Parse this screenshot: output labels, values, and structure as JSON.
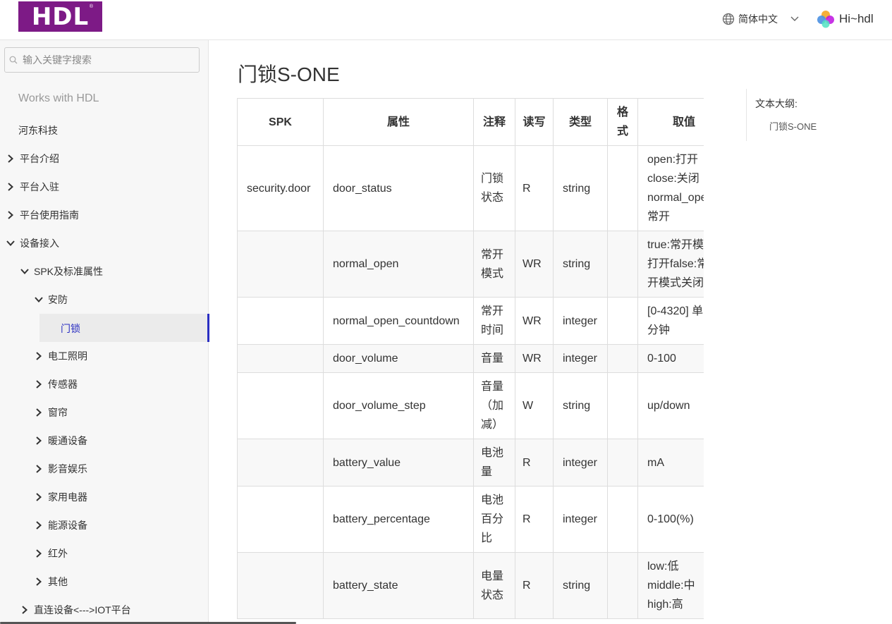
{
  "header": {
    "logo_text": "HDL",
    "logo_reg": "®",
    "language": "简体中文",
    "user_greeting": "Hi~hdl"
  },
  "colors": {
    "brand": "#7d1a86",
    "accent": "#2a2ec2"
  },
  "sidebar": {
    "search_placeholder": "输入关键字搜索",
    "works_with": "Works with HDL",
    "items": [
      {
        "label": "河东科技",
        "arrow": "none"
      },
      {
        "label": "平台介绍",
        "arrow": "right"
      },
      {
        "label": "平台入驻",
        "arrow": "right"
      },
      {
        "label": "平台使用指南",
        "arrow": "right"
      },
      {
        "label": "设备接入",
        "arrow": "down"
      },
      {
        "label": "SPK及标准属性",
        "arrow": "down"
      },
      {
        "label": "安防",
        "arrow": "down"
      },
      {
        "label": "门锁",
        "arrow": "none",
        "active": true
      },
      {
        "label": "电工照明",
        "arrow": "right"
      },
      {
        "label": "传感器",
        "arrow": "right"
      },
      {
        "label": "窗帘",
        "arrow": "right"
      },
      {
        "label": "暖通设备",
        "arrow": "right"
      },
      {
        "label": "影音娱乐",
        "arrow": "right"
      },
      {
        "label": "家用电器",
        "arrow": "right"
      },
      {
        "label": "能源设备",
        "arrow": "right"
      },
      {
        "label": "红外",
        "arrow": "right"
      },
      {
        "label": "其他",
        "arrow": "right"
      },
      {
        "label": "直连设备<--->IOT平台",
        "arrow": "right"
      }
    ]
  },
  "main": {
    "title": "门锁S-ONE",
    "table": {
      "headers": [
        "SPK",
        "属性",
        "注释",
        "读写",
        "类型",
        "格式",
        "取值"
      ],
      "rows": [
        {
          "spk": "security.door",
          "prop": "door_status",
          "note": "门锁状态",
          "rw": "R",
          "type": "string",
          "fmt": "",
          "val": [
            "open:打开",
            "close:关闭",
            "normal_ope",
            "常开"
          ]
        },
        {
          "spk": "",
          "prop": "normal_open",
          "note": "常开模式",
          "rw": "WR",
          "type": "string",
          "fmt": "",
          "val": [
            "true:常开模",
            "打开false:常",
            "开模式关闭"
          ]
        },
        {
          "spk": "",
          "prop": "normal_open_countdown",
          "note": "常开时间",
          "rw": "WR",
          "type": "integer",
          "fmt": "",
          "val": [
            "[0-4320] 单",
            "分钟"
          ]
        },
        {
          "spk": "",
          "prop": "door_volume",
          "note": "音量",
          "rw": "WR",
          "type": "integer",
          "fmt": "",
          "val": [
            "0-100"
          ]
        },
        {
          "spk": "",
          "prop": "door_volume_step",
          "note": "音量（加减）",
          "rw": "W",
          "type": "string",
          "fmt": "",
          "val": [
            "up/down"
          ]
        },
        {
          "spk": "",
          "prop": "battery_value",
          "note": "电池量",
          "rw": "R",
          "type": "integer",
          "fmt": "",
          "val": [
            "mA"
          ]
        },
        {
          "spk": "",
          "prop": "battery_percentage",
          "note": "电池百分比",
          "rw": "R",
          "type": "integer",
          "fmt": "",
          "val": [
            "0-100(%)"
          ]
        },
        {
          "spk": "",
          "prop": "battery_state",
          "note": "电量状态",
          "rw": "R",
          "type": "string",
          "fmt": "",
          "val": [
            "low:低",
            "middle:中",
            "high:高"
          ]
        }
      ]
    }
  },
  "outline": {
    "title": "文本大纲:",
    "items": [
      "门锁S-ONE"
    ]
  }
}
